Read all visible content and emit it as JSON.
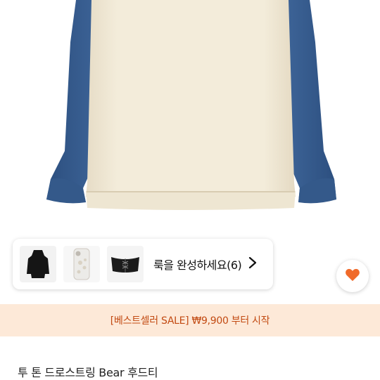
{
  "complete_look": {
    "label": "룩을 완성하세요(6)",
    "thumbnails": [
      "black-dress-icon",
      "phone-case-icon",
      "corset-belt-icon"
    ]
  },
  "favorite": {
    "icon": "heart-icon",
    "color": "#f06a2a"
  },
  "promo": {
    "text": "[베스트셀러 SALE] ₩9,900 부터 시작",
    "color": "#c24a12",
    "background": "#fde9d8"
  },
  "product": {
    "title": "투 톤 드로스트링 Bear 후드티"
  }
}
